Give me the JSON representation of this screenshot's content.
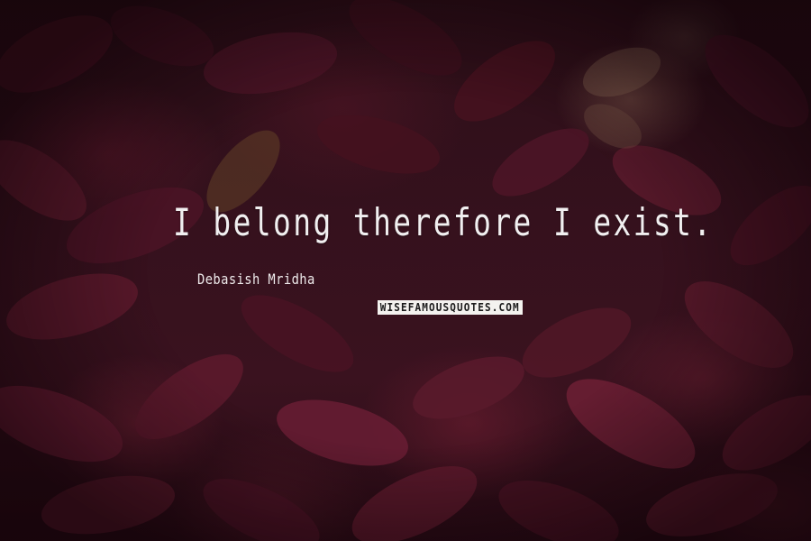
{
  "quote": {
    "text": "I belong therefore I exist.",
    "author": "Debasish Mridha"
  },
  "watermark": {
    "text": "WISEFAMOUSQUOTES.COM"
  },
  "colors": {
    "background": "#2a0d16",
    "leaf_dark": "#3a101d",
    "leaf_mid": "#5a1a2c",
    "text": "#f1eff0",
    "watermark_bg": "#f4f2ef",
    "watermark_text": "#1b1b1b"
  }
}
